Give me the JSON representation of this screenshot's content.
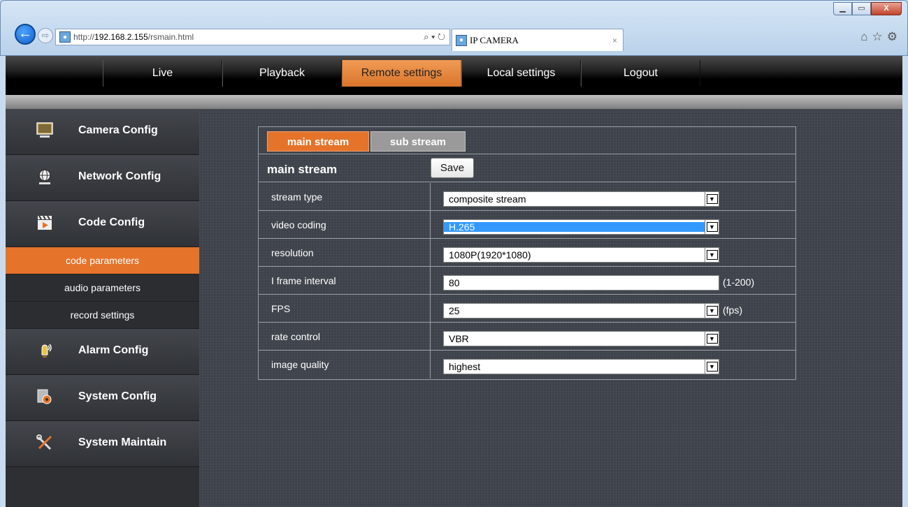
{
  "browser": {
    "url_prefix": "http://",
    "url_host": "192.168.2.155",
    "url_path": "/rsmain.html",
    "address_controls": "⌕ ▾ ↻",
    "tab_title": "IP CAMERA",
    "tab_close": "×",
    "window_buttons": [
      "▁",
      "▭",
      "X"
    ]
  },
  "nav": {
    "items": [
      {
        "label": "Live",
        "active": false
      },
      {
        "label": "Playback",
        "active": false
      },
      {
        "label": "Remote settings",
        "active": true
      },
      {
        "label": "Local settings",
        "active": false
      },
      {
        "label": "Logout",
        "active": false
      }
    ]
  },
  "sidebar": {
    "camera_config": "Camera Config",
    "network_config": "Network Config",
    "code_config": "Code Config",
    "code_parameters": "code parameters",
    "audio_parameters": "audio parameters",
    "record_settings": "record settings",
    "alarm_config": "Alarm Config",
    "system_config": "System Config",
    "system_maintain": "System Maintain"
  },
  "panel": {
    "tabs": {
      "main": "main stream",
      "sub": "sub stream"
    },
    "title": "main stream",
    "save_label": "Save",
    "rows": [
      {
        "label": "stream type",
        "value": "composite stream",
        "kind": "select"
      },
      {
        "label": "video coding",
        "value": "H.265",
        "kind": "select",
        "highlighted": true
      },
      {
        "label": "resolution",
        "value": "1080P(1920*1080)",
        "kind": "select"
      },
      {
        "label": "I frame interval",
        "value": "80",
        "kind": "text",
        "unit": "(1-200)"
      },
      {
        "label": "FPS",
        "value": "25",
        "kind": "select",
        "unit": "(fps)"
      },
      {
        "label": "rate control",
        "value": "VBR",
        "kind": "select"
      },
      {
        "label": "image quality",
        "value": "highest",
        "kind": "select"
      }
    ]
  },
  "colors": {
    "accent": "#e5732a",
    "inactive_tab": "#9a9a9a",
    "selection": "#3399ff"
  }
}
